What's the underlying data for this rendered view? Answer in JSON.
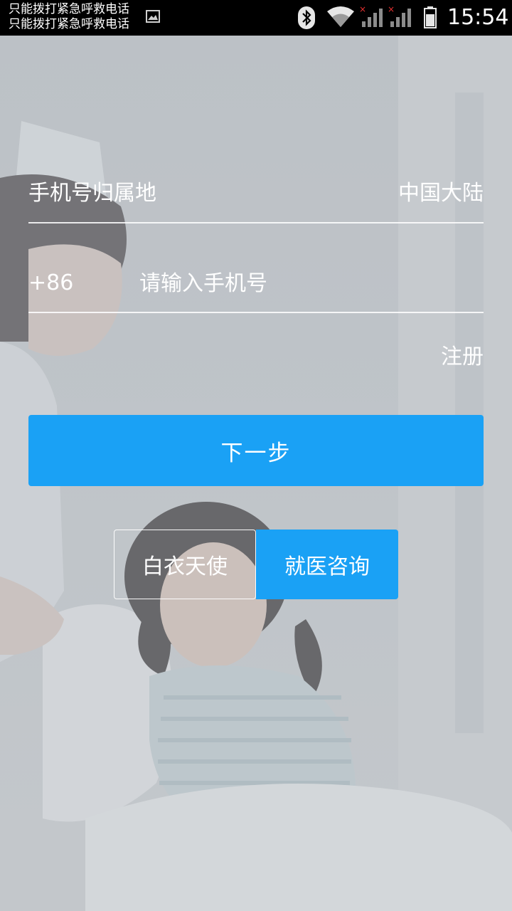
{
  "status_bar": {
    "carrier_line_1": "只能拨打紧急呼救电话",
    "carrier_line_2": "只能拨打紧急呼救电话",
    "time": "15:54",
    "icons": [
      "image-notification-icon",
      "bluetooth-icon",
      "wifi-icon",
      "signal-no-sim-icon",
      "signal-no-sim-icon",
      "battery-icon"
    ]
  },
  "form": {
    "region_label": "手机号归属地",
    "region_value": "中国大陆",
    "country_code": "+86",
    "phone_placeholder": "请输入手机号",
    "phone_value": "",
    "register_label": "注册",
    "next_label": "下一步"
  },
  "mode_switch": {
    "tabs": [
      {
        "label": "白衣天使",
        "selected": false
      },
      {
        "label": "就医咨询",
        "selected": true
      }
    ]
  },
  "colors": {
    "accent": "#1aa1f5",
    "status_bar": "#000000",
    "text": "#ffffff"
  }
}
